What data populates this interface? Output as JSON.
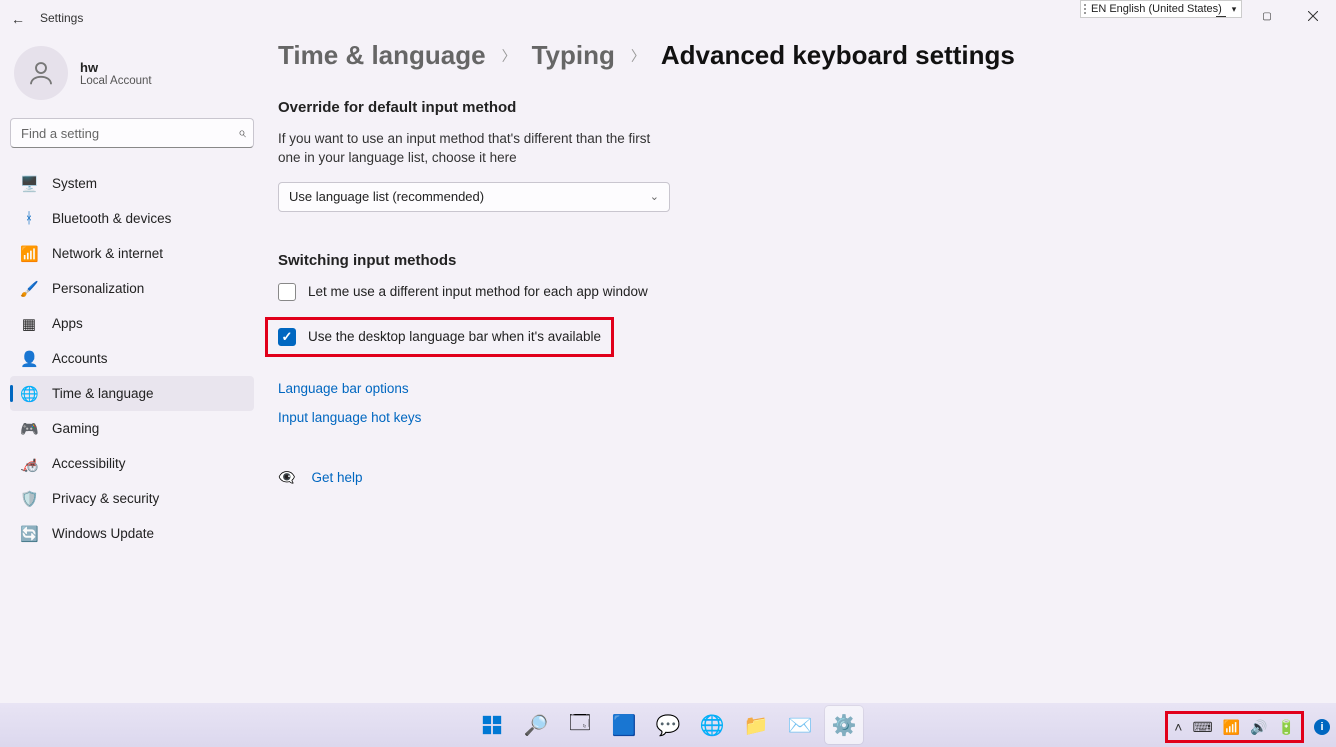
{
  "window": {
    "title": "Settings"
  },
  "langbar_float": {
    "text": "EN English (United States)"
  },
  "account": {
    "name": "hw",
    "sub": "Local Account"
  },
  "search": {
    "placeholder": "Find a setting"
  },
  "nav": {
    "system": "System",
    "bluetooth": "Bluetooth & devices",
    "network": "Network & internet",
    "personalization": "Personalization",
    "apps": "Apps",
    "accounts": "Accounts",
    "time": "Time & language",
    "gaming": "Gaming",
    "accessibility": "Accessibility",
    "privacy": "Privacy & security",
    "update": "Windows Update"
  },
  "breadcrumb": {
    "a": "Time & language",
    "b": "Typing",
    "c": "Advanced keyboard settings"
  },
  "override": {
    "heading": "Override for default input method",
    "desc": "If you want to use an input method that's different than the first one in your language list, choose it here",
    "selected": "Use language list (recommended)"
  },
  "switching": {
    "heading": "Switching input methods",
    "cb1": "Let me use a different input method for each app window",
    "cb2": "Use the desktop language bar when it's available",
    "link1": "Language bar options",
    "link2": "Input language hot keys"
  },
  "help": {
    "label": "Get help"
  }
}
